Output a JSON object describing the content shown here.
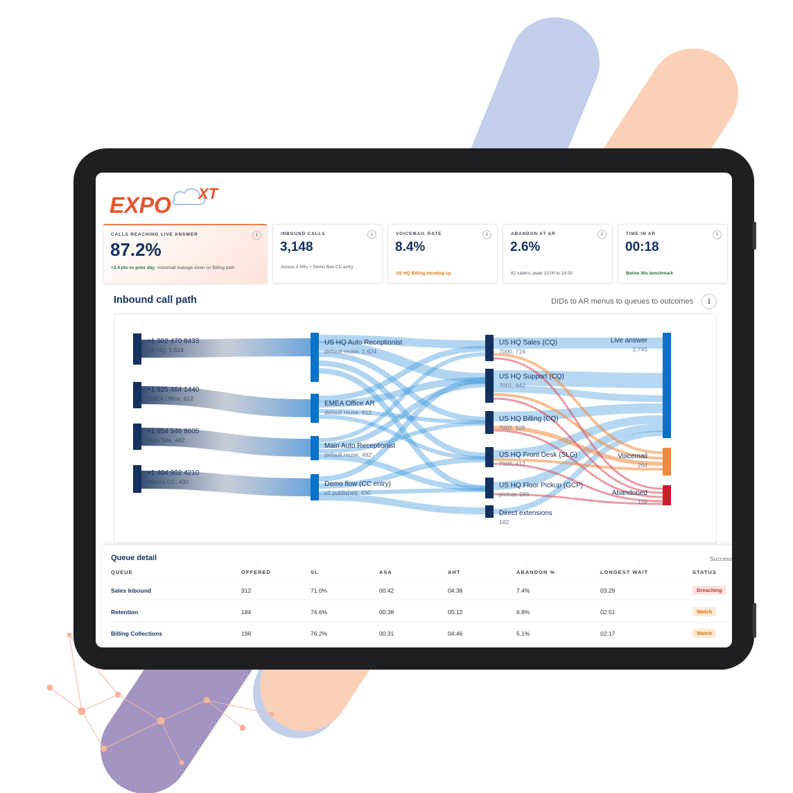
{
  "colors": {
    "brand_orange": "#e8552b",
    "navy": "#14305e",
    "blue_node": "#0a72c8",
    "voicemail": "#f08a3c",
    "abandoned": "#c81e2e"
  },
  "brand": {
    "logo_text": "EXPO",
    "logo_suffix": "XT"
  },
  "kpis": [
    {
      "label": "CALLS REACHING LIVE ANSWER",
      "value": "87.2%",
      "note_highlight": "+2.4 pts vs prior day",
      "note": ", voicemail leakage down on Billing path",
      "info": "i"
    },
    {
      "label": "INBOUND CALLS",
      "value": "3,148",
      "note": "Across 3 ARs + Demo flow CC entry",
      "info": "i"
    },
    {
      "label": "VOICEMAIL RATE",
      "value": "8.4%",
      "note": "US HQ Billing trending up",
      "info": "i"
    },
    {
      "label": "ABANDON AT AR",
      "value": "2.6%",
      "note": "82 callers, peak 13:00 to 14:00",
      "info": "i"
    },
    {
      "label": "TIME IN AR",
      "value": "00:18",
      "note": "Below 30s benchmark",
      "info": "i"
    }
  ],
  "call_path": {
    "title": "Inbound call path",
    "subtitle": "DIDs to AR menus to queues to outcomes",
    "info": "i",
    "dids": [
      {
        "number": "+1 302 470 8433",
        "detail": "US HQ, 1,624"
      },
      {
        "number": "+1 925 464 1440",
        "detail": "EMEA Office, 612"
      },
      {
        "number": "+1 954 546 8605",
        "detail": "Main Site, 482"
      },
      {
        "number": "+1 404 902 4210",
        "detail": "Atlanta CC, 430"
      }
    ],
    "ars": [
      {
        "name": "US HQ Auto Receptionist",
        "detail": "default reuse, 1,624"
      },
      {
        "name": "EMEA Office AR",
        "detail": "default reuse, 612"
      },
      {
        "name": "Main Auto Receptionist",
        "detail": "default reuse, 482"
      },
      {
        "name": "Demo flow (CC entry)",
        "detail": "v2 published, 430"
      }
    ],
    "queues": [
      {
        "name": "US HQ Sales (CQ)",
        "detail": "7000, 716"
      },
      {
        "name": "US HQ Support (CQ)",
        "detail": "7001, 942"
      },
      {
        "name": "US HQ Billing (CQ)",
        "detail": "7002, 528"
      },
      {
        "name": "US HQ Front Desk (SLG)",
        "detail": "7100, 412"
      },
      {
        "name": "US HQ Floor Pickup (GCP)",
        "detail": "pickup, 286"
      },
      {
        "name": "Direct extensions",
        "detail": "182"
      }
    ],
    "outcomes": [
      {
        "name": "Live answer",
        "value": "2,745"
      },
      {
        "name": "Voicemail",
        "value": "264"
      },
      {
        "name": "Abandoned",
        "value": "139"
      }
    ]
  },
  "queue_detail": {
    "title": "Queue detail",
    "right_label": "Success",
    "columns": [
      "QUEUE",
      "OFFERED",
      "SL",
      "ASA",
      "AHT",
      "ABANDON %",
      "LONGEST WAIT",
      "STATUS"
    ],
    "rows": [
      {
        "queue": "Sales Inbound",
        "offered": "312",
        "sl": "71.0%",
        "asa": "00:42",
        "aht": "04:38",
        "abandon": "7.4%",
        "longest": "03:29",
        "status": "Breaching"
      },
      {
        "queue": "Retention",
        "offered": "184",
        "sl": "74.6%",
        "asa": "00:38",
        "aht": "05:12",
        "abandon": "6.8%",
        "longest": "02:51",
        "status": "Watch"
      },
      {
        "queue": "Billing Collections",
        "offered": "196",
        "sl": "76.2%",
        "asa": "00:31",
        "aht": "04:46",
        "abandon": "5.1%",
        "longest": "02:17",
        "status": "Watch"
      }
    ]
  }
}
